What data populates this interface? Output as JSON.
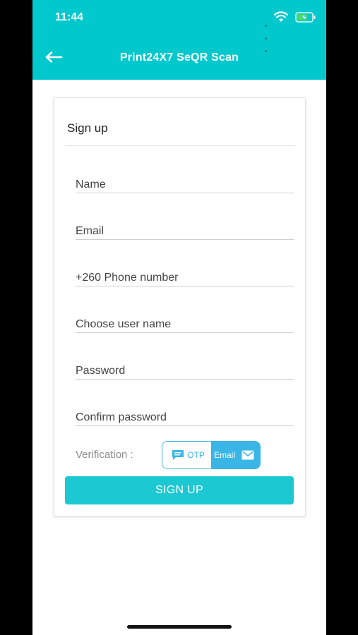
{
  "status_bar": {
    "time": "11:44"
  },
  "header": {
    "title": "Print24X7 SeQR Scan"
  },
  "form": {
    "title": "Sign up",
    "fields": {
      "name": {
        "value": "",
        "placeholder": "Name"
      },
      "email": {
        "value": "",
        "placeholder": "Email"
      },
      "phone": {
        "value": "",
        "placeholder": "+260 Phone number"
      },
      "username": {
        "value": "",
        "placeholder": "Choose user name"
      },
      "password": {
        "value": "",
        "placeholder": "Password"
      },
      "confirm_password": {
        "value": "",
        "placeholder": "Confirm password"
      }
    },
    "verification": {
      "label": "Verification :",
      "otp_label": "OTP",
      "email_label": "Email",
      "selected": "Email"
    },
    "submit_label": "SIGN UP"
  },
  "colors": {
    "header_bg": "#00c8cd",
    "accent_blue": "#3ab6e6",
    "button_bg": "#1cc8d2",
    "battery": "#4cd964"
  },
  "icons": {
    "back": "arrow-left-icon",
    "otp": "chat-message-icon",
    "email": "envelope-icon",
    "wifi": "wifi-icon",
    "battery": "battery-charging-icon"
  }
}
